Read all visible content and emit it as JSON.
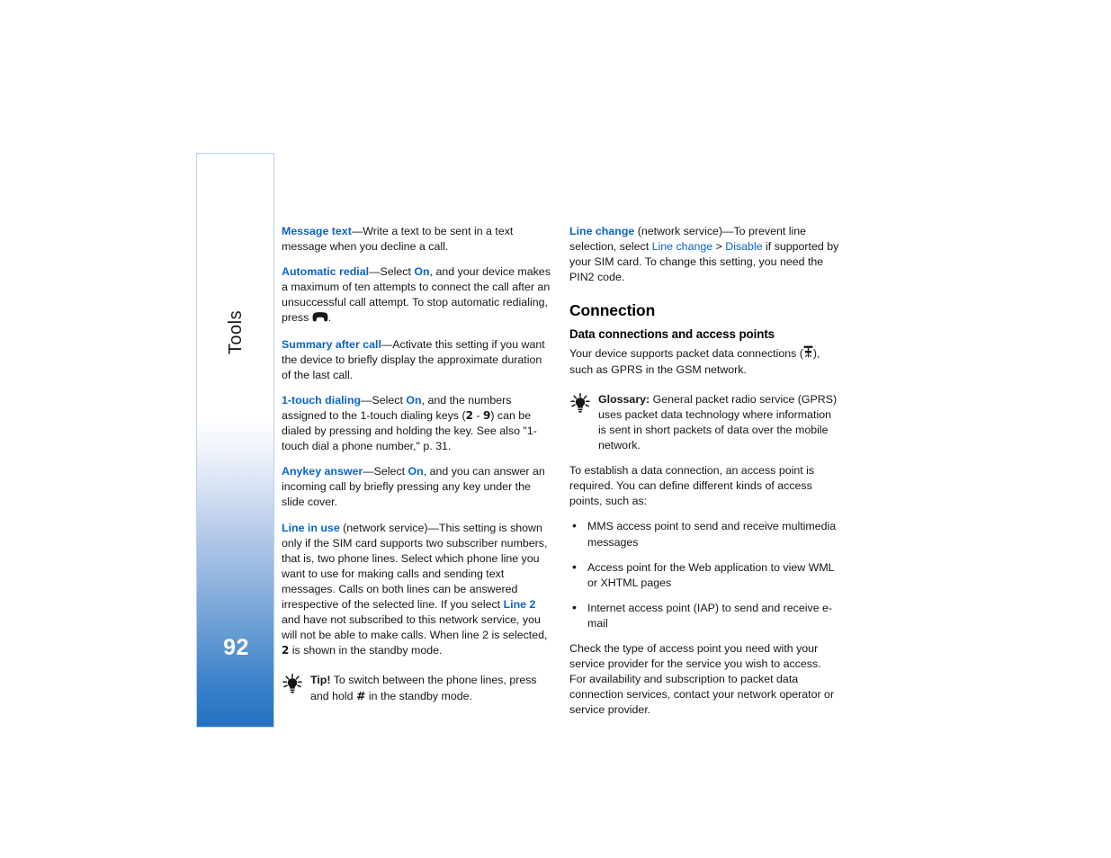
{
  "page": {
    "chapter_label": "Tools",
    "page_number": "92",
    "accent_color": "#2471c1",
    "link_color": "#0a64c8",
    "tab_border_color": "#bed0e8"
  },
  "left_column": {
    "paragraphs": [
      {
        "term": "Message text",
        "text": "—Write a text to be sent in a text message when you decline a call."
      },
      {
        "term": "Automatic redial",
        "text_a": "—Select ",
        "inline_term": "On",
        "text_b": ", and your device makes a maximum of ten attempts to connect the call after an unsuccessful call attempt. To stop automatic redialing, press ",
        "icon": "end-call-key-icon",
        "text_c": "."
      },
      {
        "term": "Summary after call",
        "text": "—Activate this setting if you want the device to briefly display the approximate duration of the last call."
      },
      {
        "term": "1-touch dialing",
        "text_a": "—Select ",
        "inline_term": "On",
        "text_b": ", and the numbers assigned to the 1-touch dialing keys (",
        "key_low": "2",
        "key_sep": " - ",
        "key_high": "9",
        "text_c": ") can be dialed by pressing and holding the key. See also \"1-touch dial a phone number,\" p. 31."
      },
      {
        "term": "Anykey answer",
        "text_a": "—Select ",
        "inline_term": "On",
        "text_b": ", and you can answer an incoming call by briefly pressing any key under the slide cover."
      },
      {
        "term": "Line in use",
        "text_a": " (network service)—This setting is shown only if the SIM card supports two subscriber numbers, that is, two phone lines. Select which phone line you want to use for making calls and sending text messages. Calls on both lines can be answered irrespective of the selected line. If you select ",
        "inline_term": "Line 2",
        "text_b": " and have not subscribed to this network service, you will not be able to make calls. When line 2 is selected, ",
        "key_glyph": "2",
        "text_c": " is shown in the standby mode."
      }
    ],
    "tip": {
      "icon": "lightbulb-tip-icon",
      "label": "Tip!",
      "text_a": " To switch between the phone lines, press and hold ",
      "key_glyph": "#",
      "text_b": " in the standby mode."
    }
  },
  "right_column": {
    "line_change": {
      "term": "Line change",
      "text_a": " (network service)—To prevent line selection, select ",
      "inline_term_a": "Line change",
      "separator": " > ",
      "inline_term_b": "Disable",
      "text_b": " if supported by your SIM card. To change this setting, you need the PIN2 code."
    },
    "section_heading": "Connection",
    "sub_heading": "Data connections and access points",
    "intro_a": "Your device supports packet data connections (",
    "intro_icon": "gprs-packet-data-icon",
    "intro_b": "), such as GPRS in the GSM network.",
    "glossary": {
      "icon": "lightbulb-tip-icon",
      "label": "Glossary:",
      "text": " General packet radio service (GPRS) uses packet data technology where information is sent in short packets of data over the mobile network."
    },
    "access_point_intro": "To establish a data connection, an access point is required. You can define different kinds of access points, such as:",
    "bullets": [
      "MMS access point to send and receive multimedia messages",
      "Access point for the Web application to view WML or XHTML pages",
      "Internet access point (IAP) to send and receive e-mail"
    ],
    "closing": "Check the type of access point you need with your service provider for the service you wish to access. For availability and subscription to packet data connection services, contact your network operator or service provider."
  }
}
